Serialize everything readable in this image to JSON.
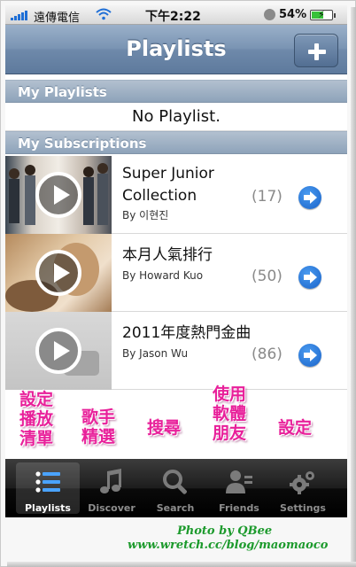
{
  "status_bar": {
    "carrier": "遠傳電信",
    "time": "下午2:22",
    "battery_percent": "54%",
    "battery_level": 0.54
  },
  "nav": {
    "title": "Playlists",
    "add_icon": "plus-icon"
  },
  "sections": {
    "my_playlists": "My Playlists",
    "empty_text": "No Playlist.",
    "my_subscriptions": "My Subscriptions"
  },
  "subscriptions": [
    {
      "title_line1": "Super Junior",
      "title_line2": "Collection",
      "author": "By 이현진",
      "count": "(17)"
    },
    {
      "title": "本月人氣排行",
      "author": "By Howard Kuo",
      "count": "(50)"
    },
    {
      "title": "2011年度熱門金曲",
      "author": "By Jason Wu",
      "count": "(86)"
    }
  ],
  "annotations": {
    "playlist_note": [
      "設定",
      "播放",
      "清單"
    ],
    "artist_note": [
      "歌手",
      "精選"
    ],
    "search_note": "搜尋",
    "friends_note": [
      "使用",
      "軟體",
      "朋友"
    ],
    "settings_note": "設定"
  },
  "tabs": [
    {
      "label": "Playlists",
      "icon": "list-icon",
      "active": true
    },
    {
      "label": "Discover",
      "icon": "music-note-icon",
      "active": false
    },
    {
      "label": "Search",
      "icon": "search-icon",
      "active": false
    },
    {
      "label": "Friends",
      "icon": "friends-icon",
      "active": false
    },
    {
      "label": "Settings",
      "icon": "gear-icon",
      "active": false
    }
  ],
  "watermark": {
    "line1": "Photo by QBee",
    "line2": "www.wretch.cc/blog/maomaoco"
  },
  "colors": {
    "accent_blue": "#1a63c9",
    "nav_blue": "#6e89aa",
    "annotation_pink": "#e8209a",
    "watermark_green": "#1c9a2c"
  }
}
